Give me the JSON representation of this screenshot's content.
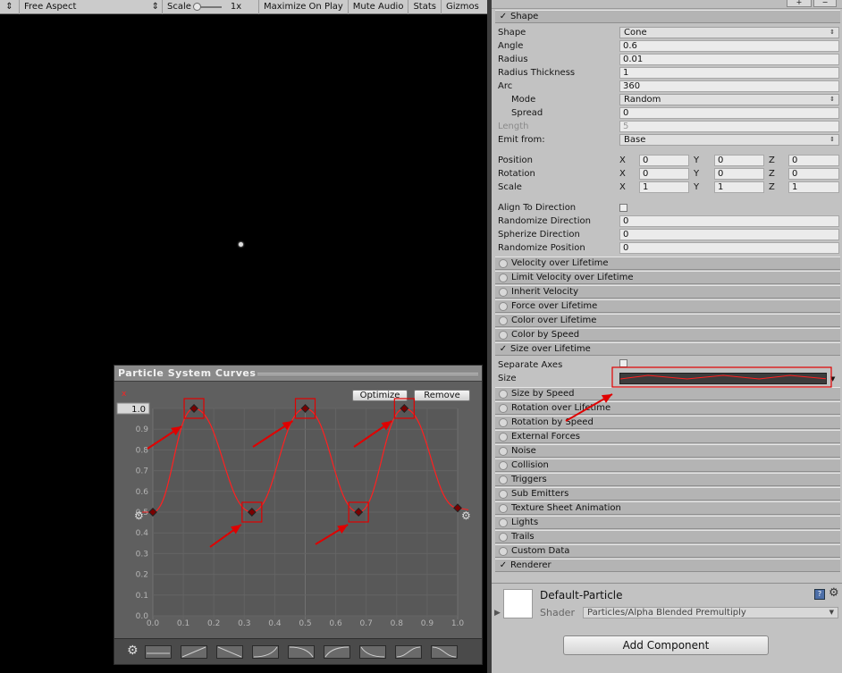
{
  "game_toolbar": {
    "display_arrow": "⇕",
    "aspect": "Free Aspect",
    "aspect_arrow": "⇕",
    "scale_label": "Scale",
    "scale_value": "1x",
    "maximize": "Maximize On Play",
    "mute": "Mute Audio",
    "stats": "Stats",
    "gizmos": "Gizmos"
  },
  "inspector": {
    "top_buttons": [
      "+",
      "−"
    ],
    "shape_module": {
      "title": "Shape",
      "shape_label": "Shape",
      "shape_value": "Cone",
      "angle_label": "Angle",
      "angle_value": "0.6",
      "radius_label": "Radius",
      "radius_value": "0.01",
      "radius_thickness_label": "Radius Thickness",
      "radius_thickness_value": "1",
      "arc_label": "Arc",
      "arc_value": "360",
      "mode_label": "Mode",
      "mode_value": "Random",
      "spread_label": "Spread",
      "spread_value": "0",
      "length_label": "Length",
      "length_value": "5",
      "emit_from_label": "Emit from:",
      "emit_from_value": "Base",
      "position_label": "Position",
      "position": {
        "x": "0",
        "y": "0",
        "z": "0"
      },
      "rotation_label": "Rotation",
      "rotation": {
        "x": "0",
        "y": "0",
        "z": "0"
      },
      "scale_label": "Scale",
      "scale": {
        "x": "1",
        "y": "1",
        "z": "1"
      },
      "axis_x": "X",
      "axis_y": "Y",
      "axis_z": "Z",
      "align_label": "Align To Direction",
      "randomize_dir_label": "Randomize Direction",
      "randomize_dir_value": "0",
      "spherize_label": "Spherize Direction",
      "spherize_value": "0",
      "randomize_pos_label": "Randomize Position",
      "randomize_pos_value": "0"
    },
    "modules_a": [
      {
        "label": "Velocity over Lifetime",
        "enabled": false
      },
      {
        "label": "Limit Velocity over Lifetime",
        "enabled": false
      },
      {
        "label": "Inherit Velocity",
        "enabled": false
      },
      {
        "label": "Force over Lifetime",
        "enabled": false
      },
      {
        "label": "Color over Lifetime",
        "enabled": false
      },
      {
        "label": "Color by Speed",
        "enabled": false
      },
      {
        "label": "Size over Lifetime",
        "enabled": true
      }
    ],
    "size_module": {
      "separate_axes_label": "Separate Axes",
      "size_label": "Size"
    },
    "modules_b": [
      {
        "label": "Size by Speed",
        "enabled": false
      },
      {
        "label": "Rotation over Lifetime",
        "enabled": false
      },
      {
        "label": "Rotation by Speed",
        "enabled": false
      },
      {
        "label": "External Forces",
        "enabled": false
      },
      {
        "label": "Noise",
        "enabled": false
      },
      {
        "label": "Collision",
        "enabled": false
      },
      {
        "label": "Triggers",
        "enabled": false
      },
      {
        "label": "Sub Emitters",
        "enabled": false
      },
      {
        "label": "Texture Sheet Animation",
        "enabled": false
      },
      {
        "label": "Lights",
        "enabled": false
      },
      {
        "label": "Trails",
        "enabled": false
      },
      {
        "label": "Custom Data",
        "enabled": false
      },
      {
        "label": "Renderer",
        "enabled": true
      }
    ],
    "material": {
      "name": "Default-Particle",
      "shader_label": "Shader",
      "shader_value": "Particles/Alpha Blended Premultiply",
      "expand_icon": "▶"
    },
    "add_component": "Add Component"
  },
  "curves_window": {
    "title": "Particle System Curves",
    "optimize": "Optimize",
    "remove": "Remove",
    "max_value": "1.0",
    "y_ticks": [
      "0.9",
      "0.8",
      "0.7",
      "0.6",
      "0.5",
      "0.4",
      "0.3",
      "0.2",
      "0.1",
      "0.0"
    ],
    "x_ticks": [
      "0.0",
      "0.1",
      "0.2",
      "0.3",
      "0.4",
      "0.5",
      "0.6",
      "0.7",
      "0.8",
      "0.9",
      "1.0"
    ],
    "curve_color": "#ff2020",
    "keys": [
      {
        "time": 0.0,
        "value": 0.5
      },
      {
        "time": 0.135,
        "value": 1.0
      },
      {
        "time": 0.325,
        "value": 0.5
      },
      {
        "time": 0.5,
        "value": 1.0
      },
      {
        "time": 0.675,
        "value": 0.5
      },
      {
        "time": 0.825,
        "value": 1.0
      },
      {
        "time": 1.0,
        "value": 0.52
      }
    ],
    "presets_count": 9
  },
  "colors": {
    "inspector_bg": "#c2c2c2",
    "module_header": "#b4b4b4",
    "annotation_red": "#e00000",
    "curve_bg": "#5f5f5f"
  }
}
